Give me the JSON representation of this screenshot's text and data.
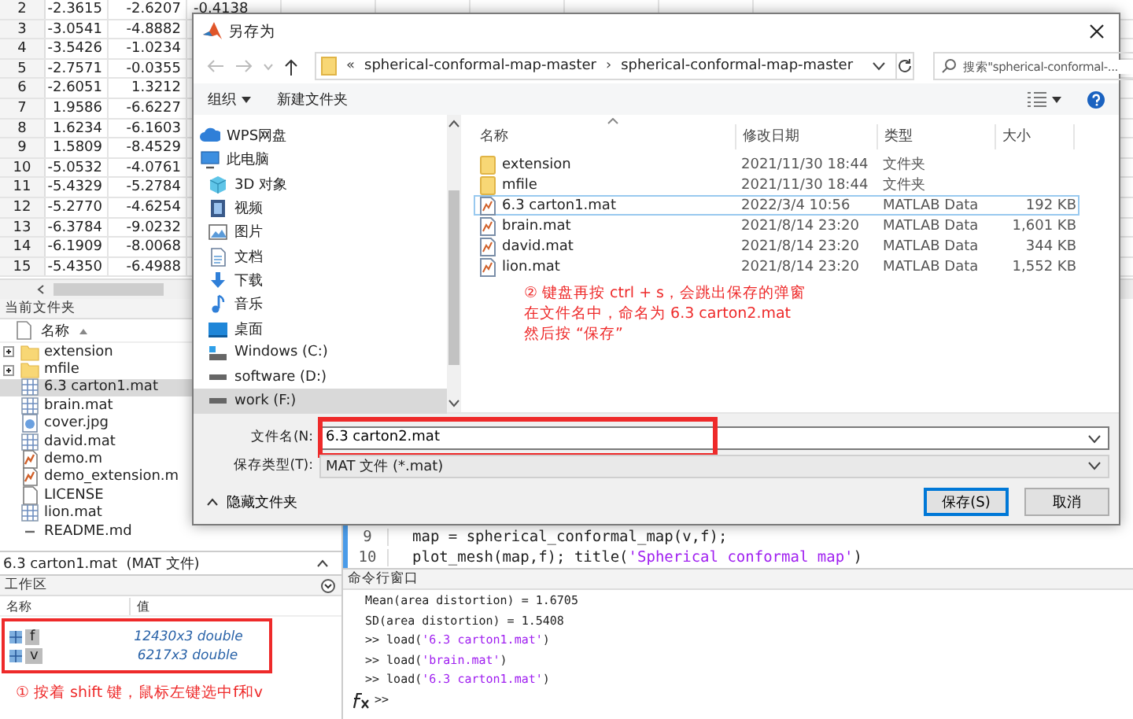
{
  "variable_table": {
    "rows": [
      {
        "index": "2",
        "cells": [
          "-2.3615",
          "-2.6207",
          "-0.4138"
        ]
      },
      {
        "index": "3",
        "cells": [
          "-3.0541",
          "-4.8882"
        ]
      },
      {
        "index": "4",
        "cells": [
          "-3.5426",
          "-1.0234"
        ]
      },
      {
        "index": "5",
        "cells": [
          "-2.7571",
          "-0.0355"
        ]
      },
      {
        "index": "6",
        "cells": [
          "-2.6051",
          "1.3212"
        ]
      },
      {
        "index": "7",
        "cells": [
          "1.9586",
          "-6.6227"
        ]
      },
      {
        "index": "8",
        "cells": [
          "1.6234",
          "-6.1603"
        ]
      },
      {
        "index": "9",
        "cells": [
          "1.5809",
          "-8.4529"
        ]
      },
      {
        "index": "10",
        "cells": [
          "-5.0532",
          "-4.0761"
        ]
      },
      {
        "index": "11",
        "cells": [
          "-5.4329",
          "-5.2784"
        ]
      },
      {
        "index": "12",
        "cells": [
          "-5.2770",
          "-4.6254"
        ]
      },
      {
        "index": "13",
        "cells": [
          "-6.3784",
          "-9.0232"
        ]
      },
      {
        "index": "14",
        "cells": [
          "-6.1909",
          "-8.0068"
        ]
      },
      {
        "index": "15",
        "cells": [
          "-5.4350",
          "-6.4988"
        ]
      }
    ]
  },
  "current_folder": {
    "title": "当前文件夹",
    "column": "名称",
    "items": [
      {
        "name": "extension",
        "kind": "folder",
        "selected": false
      },
      {
        "name": "mfile",
        "kind": "folder",
        "selected": false
      },
      {
        "name": "6.3 carton1.mat",
        "kind": "mat",
        "selected": true
      },
      {
        "name": "brain.mat",
        "kind": "mat",
        "selected": false
      },
      {
        "name": "cover.jpg",
        "kind": "image",
        "selected": false
      },
      {
        "name": "david.mat",
        "kind": "mat",
        "selected": false
      },
      {
        "name": "demo.m",
        "kind": "script",
        "selected": false
      },
      {
        "name": "demo_extension.m",
        "kind": "script",
        "selected": false
      },
      {
        "name": "LICENSE",
        "kind": "text",
        "selected": false
      },
      {
        "name": "lion.mat",
        "kind": "mat",
        "selected": false
      },
      {
        "name": "README.md",
        "kind": "markdown",
        "selected": false
      }
    ]
  },
  "status_line": {
    "text": "6.3 carton1.mat  (MAT 文件)"
  },
  "workspace": {
    "title": "工作区",
    "columns": [
      "名称",
      "值"
    ],
    "highlighted": true,
    "variables": [
      {
        "name": "f",
        "value": "12430x3 double",
        "selected": true
      },
      {
        "name": "v",
        "value": "6217x3 double",
        "selected": true
      }
    ],
    "note": "① 按着 shift 键，鼠标左键选中f和v"
  },
  "editor": {
    "lines": [
      {
        "number": "9",
        "code": [
          {
            "kind": "plain",
            "text": "map = spherical_conformal_map(v,f);"
          }
        ]
      },
      {
        "number": "10",
        "code": [
          {
            "kind": "plain",
            "text": "plot_mesh(map,f); title("
          },
          {
            "kind": "string",
            "text": "'Spherical conformal map'"
          },
          {
            "kind": "plain",
            "text": ")"
          }
        ]
      }
    ]
  },
  "command_window": {
    "title": "命令行窗口",
    "prompt": ">>",
    "lines": [
      [
        {
          "kind": "plain",
          "text": "Mean(area distortion) = 1.6705"
        }
      ],
      [
        {
          "kind": "plain",
          "text": "SD(area distortion) = 1.5408"
        }
      ],
      [
        {
          "kind": "plain",
          "text": ">> load("
        },
        {
          "kind": "string",
          "text": "'6.3 carton1.mat'"
        },
        {
          "kind": "plain",
          "text": ")"
        }
      ],
      [
        {
          "kind": "plain",
          "text": ">> load("
        },
        {
          "kind": "string",
          "text": "'brain.mat'"
        },
        {
          "kind": "plain",
          "text": ")"
        }
      ],
      [
        {
          "kind": "plain",
          "text": ">> load("
        },
        {
          "kind": "string",
          "text": "'6.3 carton1.mat'"
        },
        {
          "kind": "plain",
          "text": ")"
        }
      ]
    ]
  },
  "dialog": {
    "title": "另存为",
    "address": [
      {
        "kind": "chevron",
        "text": "«"
      },
      {
        "kind": "folder",
        "text": "spherical-conformal-map-master"
      },
      {
        "kind": "chevron",
        "text": "›"
      },
      {
        "kind": "folder",
        "text": "spherical-conformal-map-master"
      }
    ],
    "search": {
      "placeholder": "搜索\"spherical-conformal-..."
    },
    "toolbar": [
      {
        "label": "组织",
        "menu": true
      },
      {
        "label": "新建文件夹",
        "menu": false
      }
    ],
    "nav": [
      {
        "label": "WPS网盘",
        "kind": "cloud",
        "selected": false
      },
      {
        "label": "此电脑",
        "kind": "computer",
        "selected": false
      },
      {
        "label": "3D 对象",
        "kind": "cube",
        "selected": false
      },
      {
        "label": "视频",
        "kind": "video",
        "selected": false
      },
      {
        "label": "图片",
        "kind": "image",
        "selected": false
      },
      {
        "label": "文档",
        "kind": "document",
        "selected": false
      },
      {
        "label": "下载",
        "kind": "download",
        "selected": false
      },
      {
        "label": "音乐",
        "kind": "music",
        "selected": false
      },
      {
        "label": "桌面",
        "kind": "desktop",
        "selected": false
      },
      {
        "label": "Windows (C:)",
        "kind": "system-drive",
        "selected": false
      },
      {
        "label": "software (D:)",
        "kind": "drive",
        "selected": false
      },
      {
        "label": "work (F:)",
        "kind": "drive",
        "selected": true
      }
    ],
    "columns": [
      "名称",
      "修改日期",
      "类型",
      "大小"
    ],
    "files": [
      {
        "name": "extension",
        "date": "2021/11/30 18:44",
        "type": "文件夹",
        "kind": "folder",
        "selected": false
      },
      {
        "name": "mfile",
        "date": "2021/11/30 18:44",
        "type": "文件夹",
        "kind": "folder",
        "selected": false
      },
      {
        "name": "6.3 carton1.mat",
        "date": "2022/3/4 10:56",
        "type": "MATLAB Data",
        "size": "192 KB",
        "kind": "mat",
        "selected": true
      },
      {
        "name": "brain.mat",
        "date": "2021/8/14 23:20",
        "type": "MATLAB Data",
        "size": "1,601 KB",
        "kind": "mat",
        "selected": false
      },
      {
        "name": "david.mat",
        "date": "2021/8/14 23:20",
        "type": "MATLAB Data",
        "size": "344 KB",
        "kind": "mat",
        "selected": false
      },
      {
        "name": "lion.mat",
        "date": "2021/8/14 23:20",
        "type": "MATLAB Data",
        "size": "1,552 KB",
        "kind": "mat",
        "selected": false
      }
    ],
    "note": [
      "② 键盘再按 ctrl + s，会跳出保存的弹窗",
      "在文件名中，命名为 6.3 carton2.mat",
      "然后按 “保存”"
    ],
    "file_name": {
      "label": "文件名(N:",
      "value": "6.3 carton2.mat",
      "highlighted": true
    },
    "file_type": {
      "label": "保存类型(T):",
      "value": "MAT 文件 (*.mat)"
    },
    "hide_folders": "隐藏文件夹",
    "buttons": [
      {
        "label": "保存(S)",
        "default": true
      },
      {
        "label": "取消",
        "default": false
      }
    ]
  }
}
